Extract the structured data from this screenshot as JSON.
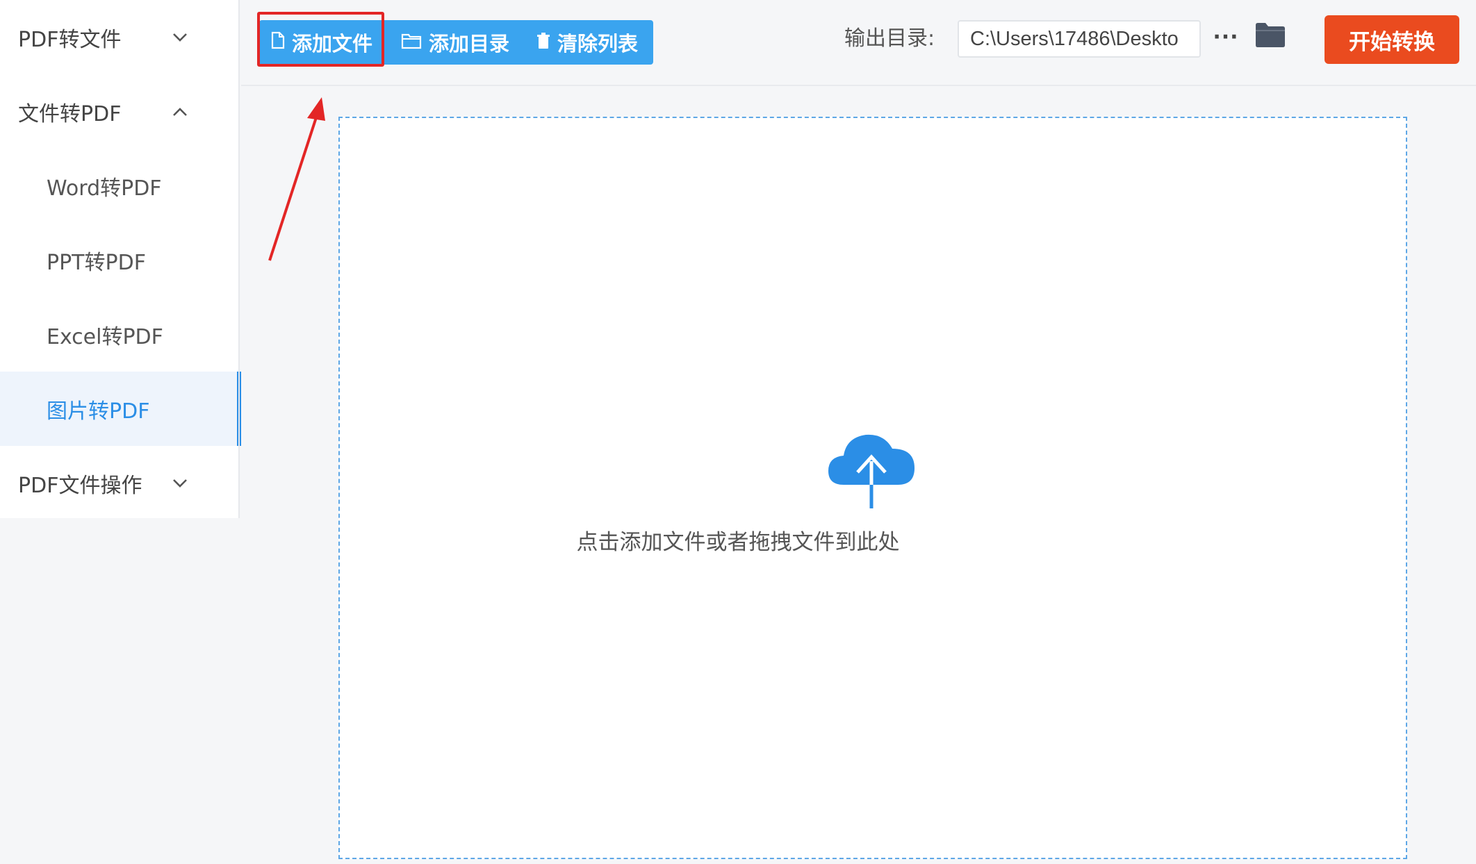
{
  "sidebar": {
    "items": [
      {
        "label": "PDF转文件",
        "type": "group",
        "expanded": false
      },
      {
        "label": "文件转PDF",
        "type": "group",
        "expanded": true
      },
      {
        "label": "Word转PDF",
        "type": "sub"
      },
      {
        "label": "PPT转PDF",
        "type": "sub"
      },
      {
        "label": "Excel转PDF",
        "type": "sub"
      },
      {
        "label": "图片转PDF",
        "type": "sub",
        "active": true
      },
      {
        "label": "PDF文件操作",
        "type": "group",
        "expanded": false
      }
    ]
  },
  "toolbar": {
    "add_file_label": "添加文件",
    "add_folder_label": "添加目录",
    "clear_list_label": "清除列表",
    "output_label": "输出目录:",
    "output_path": "C:\\Users\\17486\\Deskto",
    "more_label": "···",
    "start_label": "开始转换"
  },
  "main": {
    "drop_text": "点击添加文件或者拖拽文件到此处"
  },
  "colors": {
    "accent": "#2b8ee6",
    "toolbar_button": "#3aa4ef",
    "start_button": "#ea4b1f",
    "annotation": "#e32626"
  },
  "icons": {
    "add_file": "file-icon",
    "add_folder": "folder-outline-icon",
    "clear_list": "trash-icon",
    "output_folder": "folder-icon",
    "upload": "cloud-upload-icon"
  }
}
